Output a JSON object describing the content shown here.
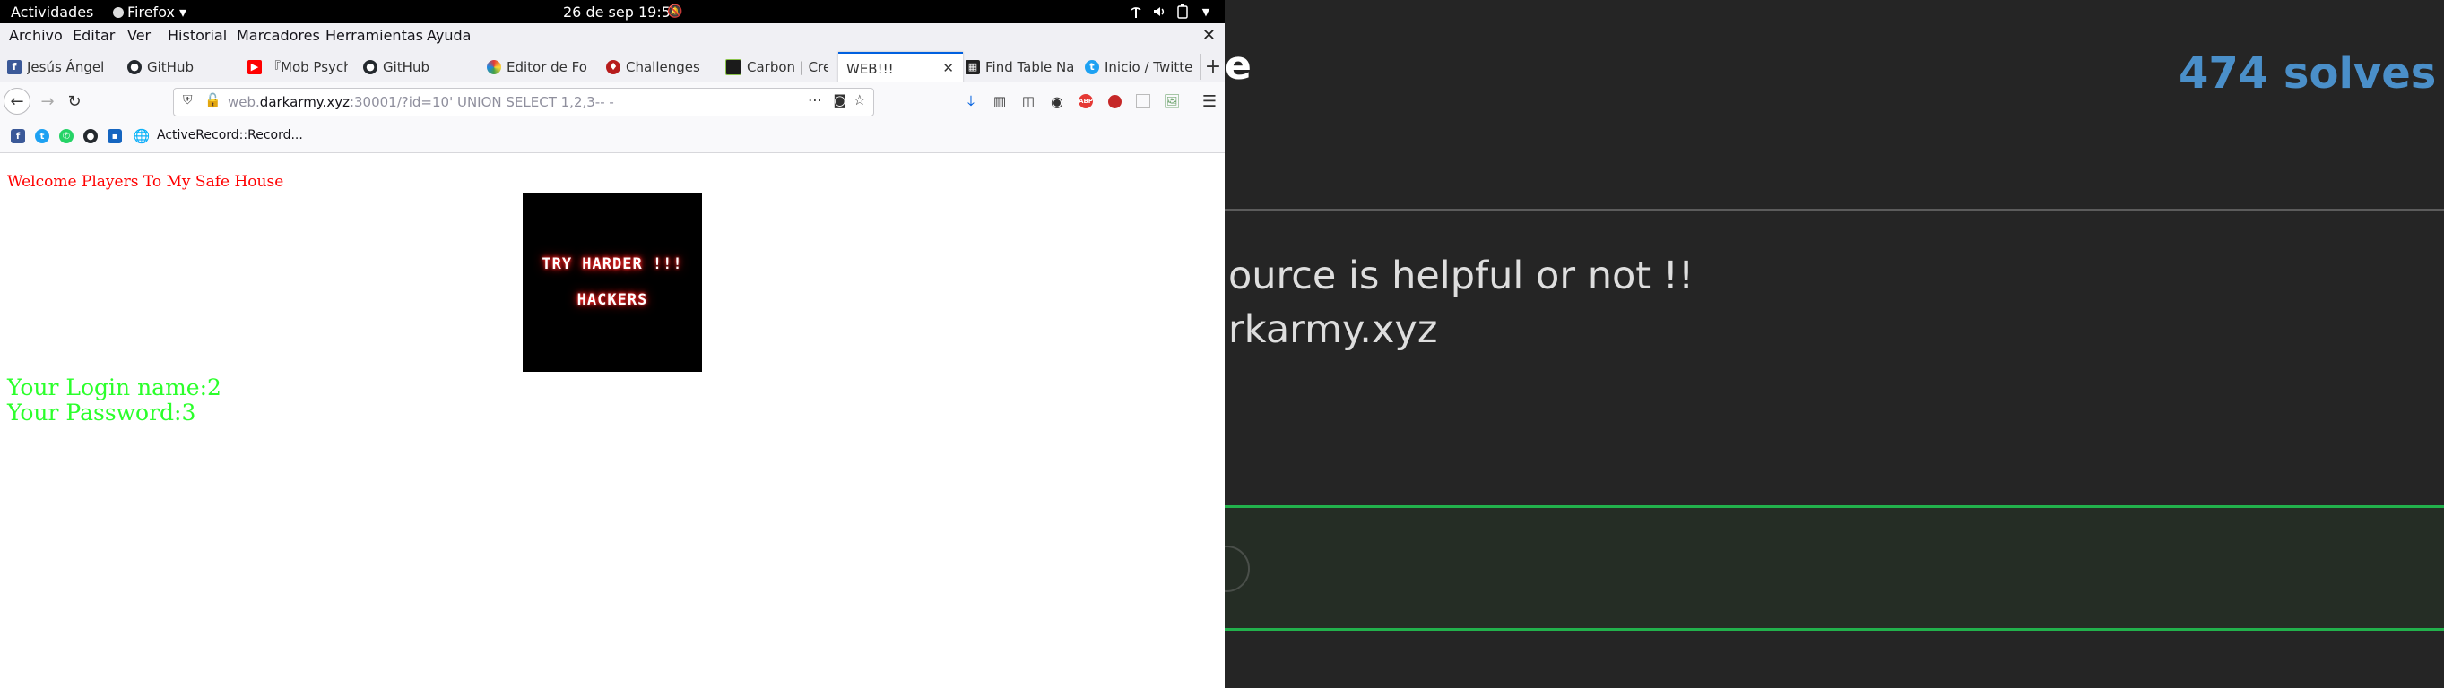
{
  "topbar": {
    "activities": "Actividades",
    "app_menu": "Firefox",
    "datetime": "26 de sep  19:52"
  },
  "menubar": {
    "items": [
      "Archivo",
      "Editar",
      "Ver",
      "Historial",
      "Marcadores",
      "Herramientas",
      "Ayuda"
    ]
  },
  "tabs": [
    {
      "label": "Jesús Ángel",
      "icon": "facebook-icon"
    },
    {
      "label": "GitHub",
      "icon": "github-icon"
    },
    {
      "label": "『Mob Psycho",
      "icon": "youtube-icon"
    },
    {
      "label": "GitHub",
      "icon": "github-icon"
    },
    {
      "label": "Editor de Foto",
      "icon": "photo-editor-icon"
    },
    {
      "label": "Challenges | D",
      "icon": "ctf-icon"
    },
    {
      "label": "Carbon | Crea",
      "icon": "carbon-icon"
    },
    {
      "label": "WEB!!!",
      "icon": ""
    },
    {
      "label": "Find Table Na",
      "icon": "table-icon"
    },
    {
      "label": "Inicio / Twitte",
      "icon": "twitter-icon"
    }
  ],
  "url": {
    "prefix": "web.",
    "host": "darkarmy.xyz",
    "rest": ":30001/?id=10' UNION SELECT 1,2,3-- -"
  },
  "bookmarks": {
    "activerecord_label": "ActiveRecord::Record..."
  },
  "page": {
    "welcome": "Welcome Players To My Safe House",
    "logo_line1": "TRY HARDER !!!",
    "logo_line2": "HACKERS",
    "login_name": "Your Login name:2",
    "password": "Your Password:3"
  },
  "right_panel": {
    "title_fragment": "e",
    "solves": "474 solves /",
    "desc_line1": "ource is helpful or not !!",
    "desc_line2": "rkarmy.xyz",
    "accent_blue": "#4a8fc9",
    "accent_green": "#22b14c"
  }
}
